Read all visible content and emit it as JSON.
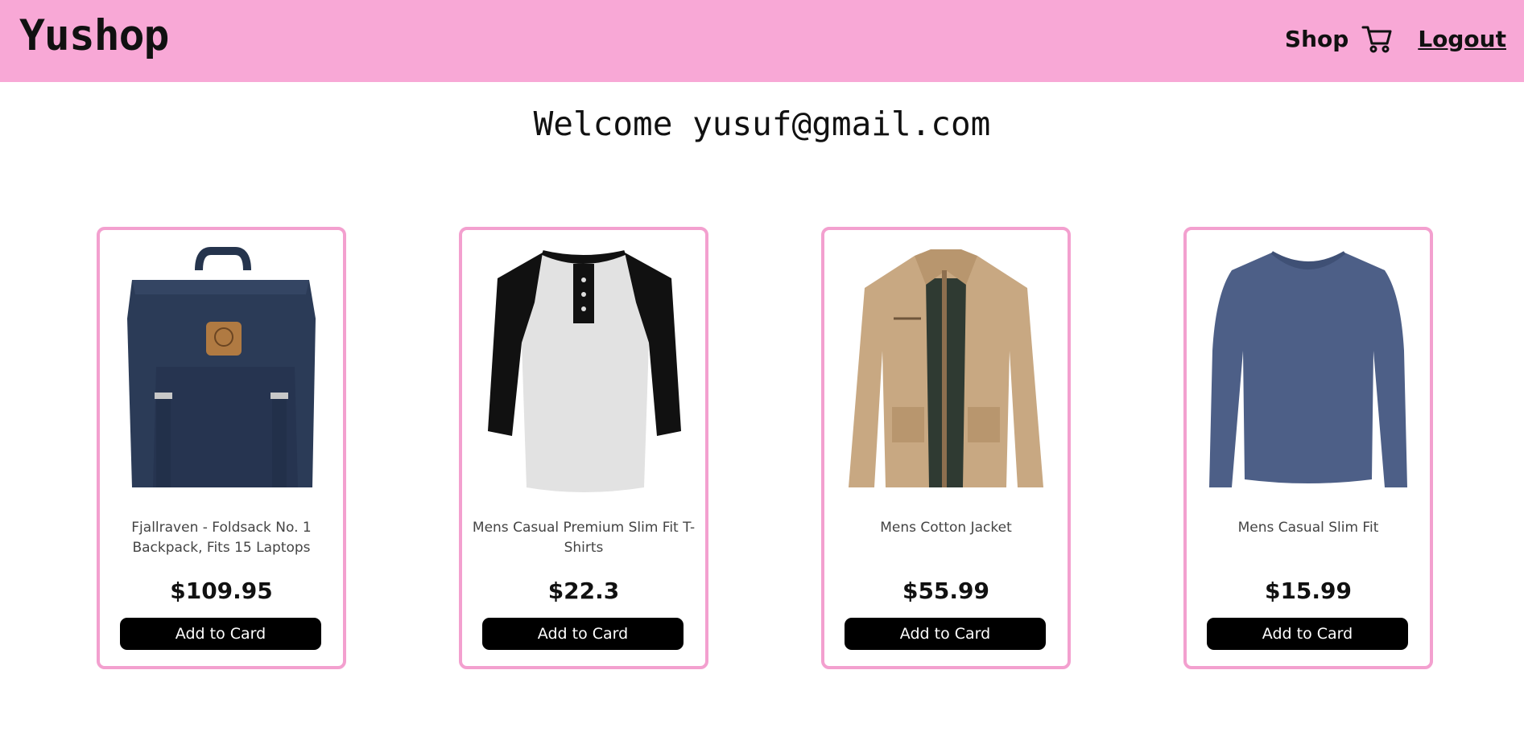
{
  "header": {
    "brand": "Yushop",
    "shop_label": "Shop",
    "cart_icon": "cart-icon",
    "logout_label": "Logout",
    "background": "#f8a8d6"
  },
  "welcome": "Welcome yusuf@gmail.com",
  "products": [
    {
      "title": "Fjallraven - Foldsack No. 1 Backpack, Fits 15 Laptops",
      "price": "$109.95",
      "button": "Add to Card",
      "image": "navy backpack"
    },
    {
      "title": "Mens Casual Premium Slim Fit T-Shirts",
      "price": "$22.3",
      "button": "Add to Card",
      "image": "raglan henley t-shirt"
    },
    {
      "title": "Mens Cotton Jacket",
      "price": "$55.99",
      "button": "Add to Card",
      "image": "beige cotton jacket"
    },
    {
      "title": "Mens Casual Slim Fit",
      "price": "$15.99",
      "button": "Add to Card",
      "image": "blue long sleeve shirt"
    }
  ],
  "colors": {
    "accent_pink": "#f8a8d6",
    "card_border": "#f3a0cf",
    "button_bg": "#000000",
    "button_text": "#ffffff"
  }
}
